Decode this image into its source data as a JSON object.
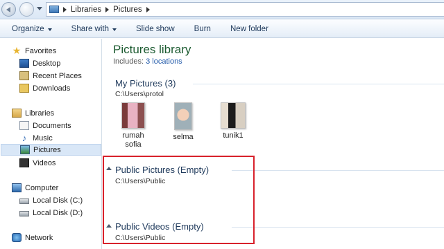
{
  "address": {
    "crumbs": [
      "Libraries",
      "Pictures"
    ]
  },
  "toolbar": {
    "organize": "Organize",
    "share_with": "Share with",
    "slide_show": "Slide show",
    "burn": "Burn",
    "new_folder": "New folder"
  },
  "nav": {
    "favorites": "Favorites",
    "desktop": "Desktop",
    "recent_places": "Recent Places",
    "downloads": "Downloads",
    "libraries": "Libraries",
    "documents": "Documents",
    "music": "Music",
    "pictures": "Pictures",
    "videos": "Videos",
    "computer": "Computer",
    "disk_c": "Local Disk (C:)",
    "disk_d": "Local Disk (D:)",
    "network": "Network"
  },
  "library": {
    "title": "Pictures library",
    "includes_label": "Includes:",
    "includes_link": "3 locations"
  },
  "groups": {
    "my_pictures": {
      "title": "My Pictures (3)",
      "path": "C:\\Users\\protol"
    },
    "public_pictures": {
      "title": "Public Pictures (Empty)",
      "path": "C:\\Users\\Public"
    },
    "public_videos": {
      "title": "Public Videos (Empty)",
      "path": "C:\\Users\\Public"
    }
  },
  "files": {
    "rumah_line1": "rumah",
    "rumah_line2": "sofia",
    "selma": "selma",
    "tunik": "tunik1"
  },
  "colors": {
    "highlight": "#d8212b",
    "title_green": "#1e5c32",
    "link_blue": "#1e57a8"
  }
}
